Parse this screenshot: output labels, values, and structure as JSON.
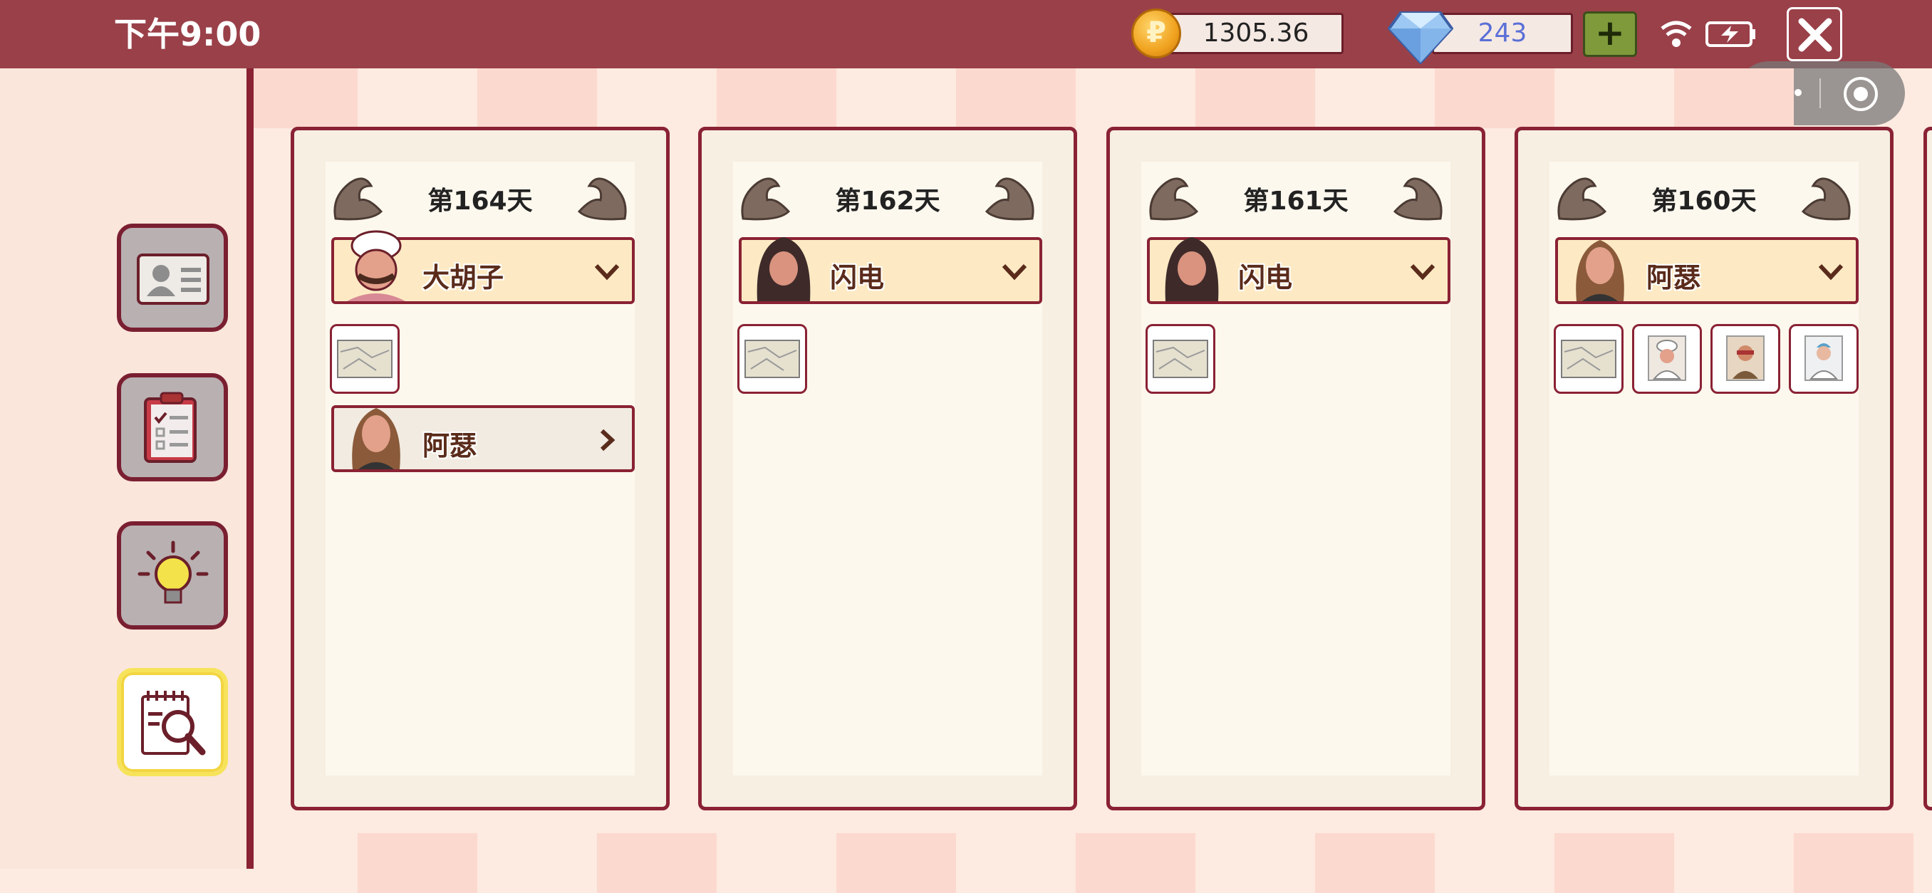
{
  "status_bar": {
    "time": "下午9:00",
    "coins": "1305.36",
    "gems": "243",
    "coin_symbol": "₽",
    "colors": {
      "bar": "#9a4049",
      "gem_text": "#5a6fd6",
      "plus_button": "#7e9a3b"
    }
  },
  "sidebar": {
    "buttons": [
      {
        "name": "id-card-button",
        "icon": "id-card-icon",
        "active": false
      },
      {
        "name": "clipboard-button",
        "icon": "clipboard-checklist-icon",
        "active": false
      },
      {
        "name": "hint-button",
        "icon": "lightbulb-icon",
        "active": false
      },
      {
        "name": "investigate-button",
        "icon": "magnifier-notepad-icon",
        "active": true
      }
    ]
  },
  "days": [
    {
      "title": "第164天",
      "character": {
        "name": "大胡子",
        "portrait": "chef-portrait"
      },
      "items": [
        "map-item"
      ],
      "sub_character": {
        "name": "阿瑟",
        "portrait": "longhair-portrait"
      }
    },
    {
      "title": "第162天",
      "character": {
        "name": "闪电",
        "portrait": "hooded-portrait"
      },
      "items": [
        "map-item"
      ]
    },
    {
      "title": "第161天",
      "character": {
        "name": "闪电",
        "portrait": "hooded-portrait"
      },
      "items": [
        "map-item"
      ]
    },
    {
      "title": "第160天",
      "character": {
        "name": "阿瑟",
        "portrait": "longhair-portrait"
      },
      "items": [
        "map-item",
        "chef-card-item",
        "old-man-card-item",
        "doctor-card-item"
      ]
    }
  ]
}
